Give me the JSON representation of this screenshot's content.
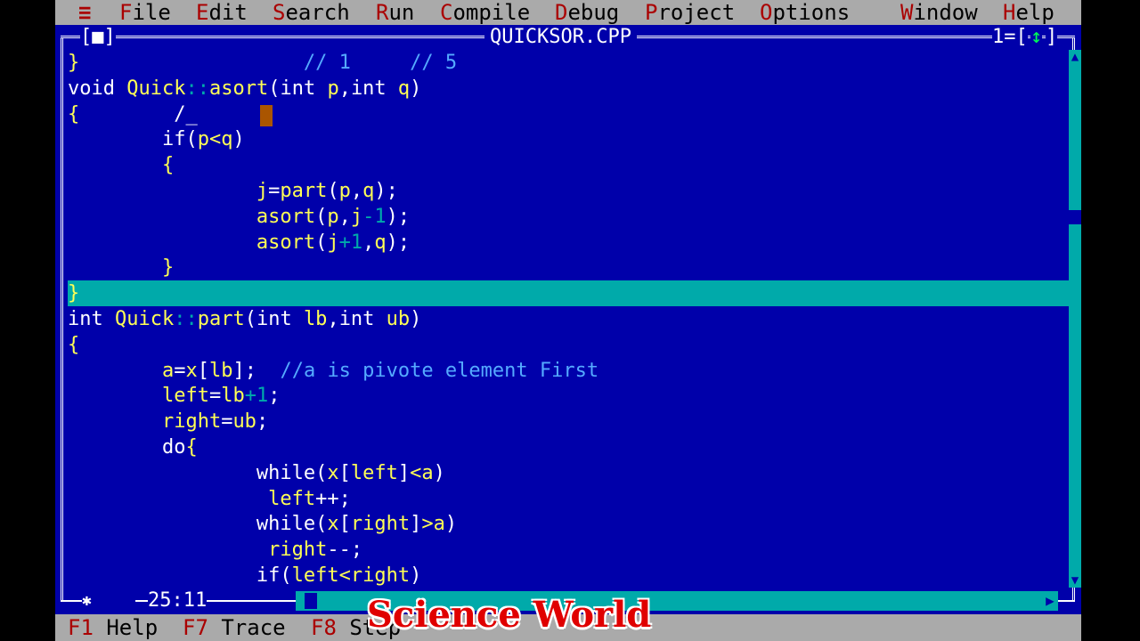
{
  "menu": {
    "system": "≡",
    "items": [
      {
        "hotkey": "F",
        "rest": "ile"
      },
      {
        "hotkey": "E",
        "rest": "dit"
      },
      {
        "hotkey": "S",
        "rest": "earch"
      },
      {
        "hotkey": "R",
        "rest": "un"
      },
      {
        "hotkey": "C",
        "rest": "ompile"
      },
      {
        "hotkey": "D",
        "rest": "ebug"
      },
      {
        "hotkey": "P",
        "rest": "roject"
      },
      {
        "hotkey": "O",
        "rest": "ptions"
      },
      {
        "hotkey": "W",
        "rest": "indow"
      },
      {
        "hotkey": "H",
        "rest": "elp"
      }
    ]
  },
  "window": {
    "close_box": "[■]",
    "title": "QUICKSOR.CPP",
    "number": "1=[",
    "zoom_box": "↕",
    "zoom_close": "]"
  },
  "code_lines": [
    [
      [
        "}",
        "y"
      ],
      [
        "                   // 1     // 5",
        "cm"
      ]
    ],
    [
      [
        "void ",
        "w"
      ],
      [
        "Quick",
        "y"
      ],
      [
        "::",
        "d"
      ],
      [
        "asort",
        "y"
      ],
      [
        "(",
        "w"
      ],
      [
        "int ",
        "w"
      ],
      [
        "p",
        "y"
      ],
      [
        ",",
        "w"
      ],
      [
        "int ",
        "w"
      ],
      [
        "q",
        "y"
      ],
      [
        ")",
        "w"
      ]
    ],
    [
      [
        "{",
        "y"
      ],
      [
        "        /_",
        "w"
      ]
    ],
    [
      [
        "        if",
        "w"
      ],
      [
        "(",
        "w"
      ],
      [
        "p<q",
        "y"
      ],
      [
        ")",
        "w"
      ]
    ],
    [
      [
        "        {",
        "y"
      ]
    ],
    [
      [
        "                j",
        "y"
      ],
      [
        "=",
        "w"
      ],
      [
        "part",
        "y"
      ],
      [
        "(",
        "w"
      ],
      [
        "p",
        "y"
      ],
      [
        ",",
        "w"
      ],
      [
        "q",
        "y"
      ],
      [
        ");",
        "w"
      ]
    ],
    [
      [
        "                asort",
        "y"
      ],
      [
        "(",
        "w"
      ],
      [
        "p",
        "y"
      ],
      [
        ",",
        "w"
      ],
      [
        "j",
        "y"
      ],
      [
        "-1",
        "d"
      ],
      [
        ");",
        "w"
      ]
    ],
    [
      [
        "                asort",
        "y"
      ],
      [
        "(",
        "w"
      ],
      [
        "j",
        "y"
      ],
      [
        "+1",
        "d"
      ],
      [
        ",",
        "w"
      ],
      [
        "q",
        "y"
      ],
      [
        ");",
        "w"
      ]
    ],
    [
      [
        "        }",
        "y"
      ]
    ],
    [
      [
        "}",
        "y"
      ]
    ],
    [
      [
        "int ",
        "w"
      ],
      [
        "Quick",
        "y"
      ],
      [
        "::",
        "d"
      ],
      [
        "part",
        "y"
      ],
      [
        "(",
        "w"
      ],
      [
        "int ",
        "w"
      ],
      [
        "lb",
        "y"
      ],
      [
        ",",
        "w"
      ],
      [
        "int ",
        "w"
      ],
      [
        "ub",
        "y"
      ],
      [
        ")",
        "w"
      ]
    ],
    [
      [
        "{",
        "y"
      ]
    ],
    [
      [
        "        a",
        "y"
      ],
      [
        "=",
        "w"
      ],
      [
        "x",
        "y"
      ],
      [
        "[",
        "w"
      ],
      [
        "lb",
        "y"
      ],
      [
        "];",
        "w"
      ],
      [
        "  //a is pivote element First",
        "cm"
      ]
    ],
    [
      [
        "        left",
        "y"
      ],
      [
        "=",
        "w"
      ],
      [
        "lb",
        "y"
      ],
      [
        "+1",
        "d"
      ],
      [
        ";",
        "w"
      ]
    ],
    [
      [
        "        right",
        "y"
      ],
      [
        "=",
        "w"
      ],
      [
        "ub",
        "y"
      ],
      [
        ";",
        "w"
      ]
    ],
    [
      [
        "        do",
        "w"
      ],
      [
        "{",
        "y"
      ]
    ],
    [
      [
        "                while",
        "w"
      ],
      [
        "(",
        "w"
      ],
      [
        "x",
        "y"
      ],
      [
        "[",
        "w"
      ],
      [
        "left",
        "y"
      ],
      [
        "]",
        "w"
      ],
      [
        "<a",
        "y"
      ],
      [
        ")",
        "w"
      ]
    ],
    [
      [
        "                 left",
        "y"
      ],
      [
        "++;",
        "w"
      ]
    ],
    [
      [
        "                while",
        "w"
      ],
      [
        "(",
        "w"
      ],
      [
        "x",
        "y"
      ],
      [
        "[",
        "w"
      ],
      [
        "right",
        "y"
      ],
      [
        "]",
        "w"
      ],
      [
        ">a",
        "y"
      ],
      [
        ")",
        "w"
      ]
    ],
    [
      [
        "                 right",
        "y"
      ],
      [
        "--;",
        "w"
      ]
    ],
    [
      [
        "                if",
        "w"
      ],
      [
        "(",
        "w"
      ],
      [
        "left<right",
        "y"
      ],
      [
        ")",
        "w"
      ]
    ]
  ],
  "highlight_line": 9,
  "cursor_position": "25:11",
  "status": [
    {
      "key": "F1",
      "label": "Help"
    },
    {
      "key": "F7",
      "label": "Trace"
    },
    {
      "key": "F8",
      "label": "Step"
    }
  ],
  "watermark": "Science World",
  "colors": {
    "editor_bg": "#0000aa",
    "menu_bg": "#aaaaaa",
    "hotkey": "#aa0000",
    "highlight_bg": "#00aaaa",
    "code_text": "#ffff55",
    "cursor": "#aa5500"
  }
}
